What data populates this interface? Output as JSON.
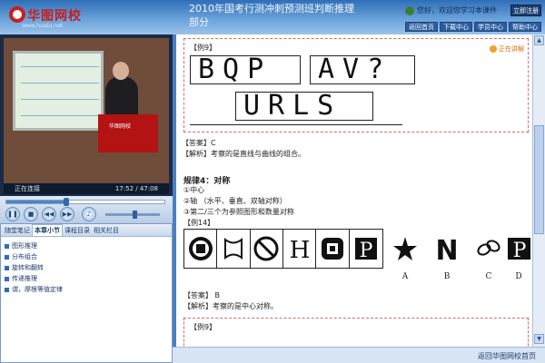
{
  "header": {
    "logo_text": "华图网校",
    "logo_url": "www.huatu.net",
    "course_title": "2010年国考行测冲刺预测班判断推理部分",
    "welcome": "您好，欢迎您学习本课件",
    "logout": "立即注册",
    "nav": [
      "返回首页",
      "下载中心",
      "学员中心",
      "帮助中心"
    ]
  },
  "video": {
    "status": "正在连接",
    "time": "17:52 / 47:08",
    "progress": 0.38,
    "volume": 0.5,
    "podium_text": "华图网校"
  },
  "nav_panel": {
    "tabs": [
      "随堂笔记",
      "本章小节",
      "课程目录",
      "相关栏目"
    ],
    "active_tab": 1,
    "items": [
      "图形推理",
      "分布组合",
      "旋转和翻转",
      "传递推理",
      "谓，摩根等值定律"
    ]
  },
  "content": {
    "example9_label": "【例9】",
    "live_label": "正在讲解",
    "row1_box1": "BQP",
    "row1_box2": "AV?",
    "row2_box": "URLS",
    "answer9": "【答案】C",
    "explain9": "【解析】考察的是直线与曲线的组合。",
    "rule_title": "规律4：对称",
    "rule_lines": [
      "①中心",
      "②轴 （水平、垂直、双轴对称）",
      "③第二/三个为参照图形和数量对称"
    ],
    "example14_label": "【例14】",
    "options": [
      "A",
      "B",
      "C",
      "D"
    ],
    "answer14": "【答案】 B",
    "explain14": "【解析】考察的是中心对称。",
    "example9b_label": "【例9】"
  },
  "footer": {
    "home_link": "返回华图网校首页"
  }
}
